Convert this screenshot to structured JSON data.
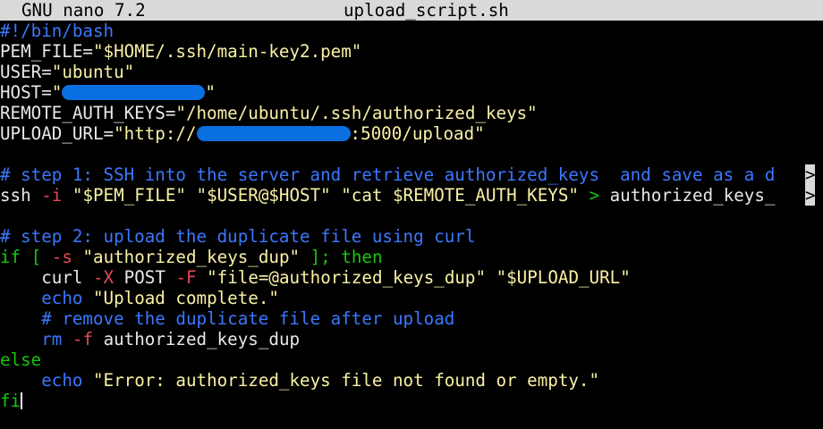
{
  "titlebar": {
    "app_name": "GNU nano 7.2",
    "file_name": "upload_script.sh"
  },
  "colors": {
    "titlebar_bg": "#d9d9d9",
    "comment": "#3b78ff",
    "variable": "#16c60c",
    "string": "#f9f1a5",
    "option": "#e74856",
    "text": "#e8e8e8",
    "redaction": "#0a6fe0"
  },
  "code": {
    "shebang": "#!/bin/bash",
    "pem_var": "PEM_FILE",
    "pem_val": "\"$HOME/.ssh/main-key2.pem\"",
    "user_var": "USER",
    "user_val": "\"ubuntu\"",
    "host_var": "HOST",
    "host_open": "\"",
    "host_close": "\"",
    "rak_var": "REMOTE_AUTH_KEYS",
    "rak_val": "\"/home/ubuntu/.ssh/authorized_keys\"",
    "url_var": "UPLOAD_URL",
    "url_open": "\"http://",
    "url_close": ":5000/upload\"",
    "comment1": "# step 1: SSH into the server and retrieve authorized_keys  and save as a d",
    "ssh_cmd": "ssh",
    "ssh_opt": "-i",
    "ssh_args": "\"$PEM_FILE\" \"$USER@$HOST\" \"cat $REMOTE_AUTH_KEYS\"",
    "ssh_redirect": ">",
    "ssh_target": "authorized_keys_",
    "comment2": "# step 2: upload the duplicate file using curl",
    "if_kw": "if",
    "if_bracket": "[",
    "if_opt": "-s",
    "if_str": "\"authorized_keys_dup\"",
    "if_end": "];",
    "then_kw": "then",
    "curl_cmd": "curl",
    "curl_opt_x": "-X",
    "curl_post": "POST",
    "curl_opt_f": "-F",
    "curl_args": "\"file=@authorized_keys_dup\" \"$UPLOAD_URL\"",
    "echo1_kw": "echo",
    "echo1_str": "\"Upload complete.\"",
    "comment3": "# remove the duplicate file after upload",
    "rm_cmd": "rm",
    "rm_opt": "-f",
    "rm_arg": "authorized_keys_dup",
    "else_kw": "else",
    "echo2_kw": "echo",
    "echo2_str": "\"Error: authorized_keys file not found or empty.\"",
    "fi_kw": "fi"
  },
  "overflow_marker": ">"
}
